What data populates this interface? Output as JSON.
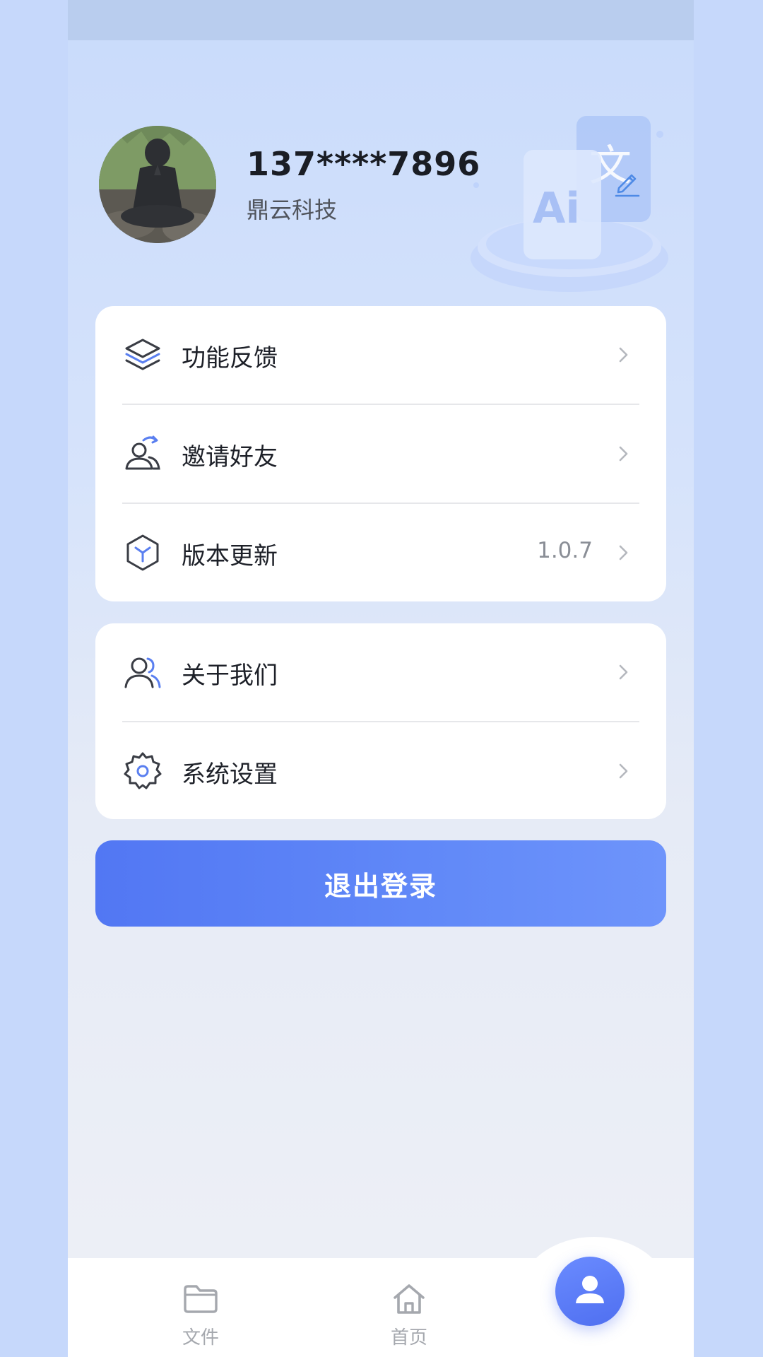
{
  "profile": {
    "phone": "137****7896",
    "company": "鼎云科技"
  },
  "menu_group_1": [
    {
      "label": "功能反馈",
      "icon": "layers-icon",
      "value": ""
    },
    {
      "label": "邀请好友",
      "icon": "invite-users-icon",
      "value": ""
    },
    {
      "label": "版本更新",
      "icon": "cube-icon",
      "value": "1.0.7"
    }
  ],
  "menu_group_2": [
    {
      "label": "关于我们",
      "icon": "about-users-icon"
    },
    {
      "label": "系统设置",
      "icon": "gear-icon"
    }
  ],
  "logout_label": "退出登录",
  "tabbar": {
    "files_label": "文件",
    "home_label": "首页",
    "active_tab": "profile"
  },
  "colors": {
    "accent": "#5277f3",
    "background": "#c6d8fb",
    "card": "#ffffff",
    "text": "#1d2028",
    "muted": "#8a8e96"
  }
}
